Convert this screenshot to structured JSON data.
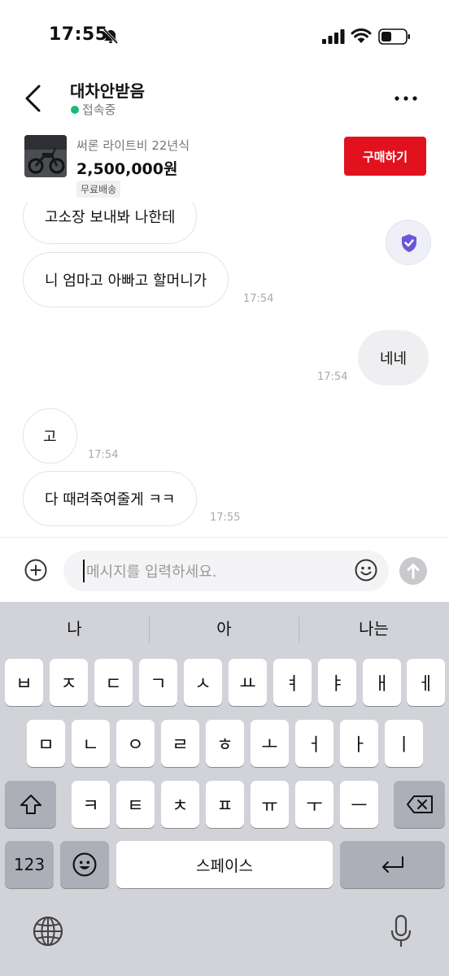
{
  "status_bar": {
    "time": "17:55"
  },
  "header": {
    "title": "대차안받음",
    "status": "접속중"
  },
  "product": {
    "name": "써론 라이트비 22년식",
    "price": "2,500,000원",
    "badge": "무료배송",
    "buy_label": "구매하기"
  },
  "messages": [
    {
      "sender": "other",
      "text": "고소장 보내봐 나한테",
      "time": ""
    },
    {
      "sender": "other",
      "text": "니 엄마고 아빠고 할머니가",
      "time": "17:54"
    },
    {
      "sender": "me",
      "text": "네네",
      "time": "17:54"
    },
    {
      "sender": "other",
      "text": "고",
      "time": "17:54"
    },
    {
      "sender": "other",
      "text": "다 때려죽여줄게 ㅋㅋ",
      "time": "17:55"
    }
  ],
  "input": {
    "placeholder": "메시지를 입력하세요."
  },
  "keyboard": {
    "suggestions": [
      "나",
      "아",
      "나는"
    ],
    "row1": [
      "ㅂ",
      "ㅈ",
      "ㄷ",
      "ㄱ",
      "ㅅ",
      "ㅛ",
      "ㅕ",
      "ㅑ",
      "ㅐ",
      "ㅔ"
    ],
    "row2": [
      "ㅁ",
      "ㄴ",
      "ㅇ",
      "ㄹ",
      "ㅎ",
      "ㅗ",
      "ㅓ",
      "ㅏ",
      "ㅣ"
    ],
    "row3": [
      "ㅋ",
      "ㅌ",
      "ㅊ",
      "ㅍ",
      "ㅠ",
      "ㅜ",
      "ㅡ"
    ],
    "numbers_label": "123",
    "space_label": "스페이스"
  },
  "colors": {
    "accent": "#e1121e",
    "online": "#1db978",
    "keyboard_bg": "#d1d3d9"
  }
}
